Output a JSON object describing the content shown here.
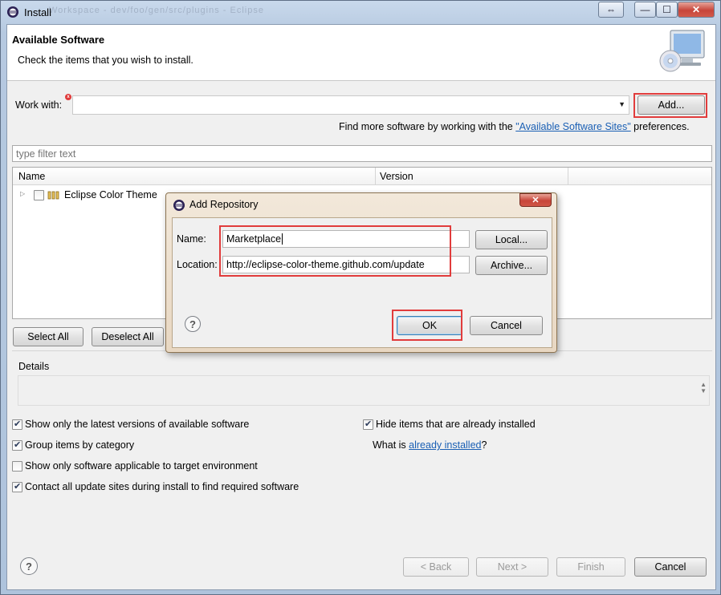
{
  "window": {
    "title": "Install",
    "ghost_title": "Workspace - dev/foo/gen/src/plugins  -  Eclipse",
    "controls": {
      "restore": "⇔",
      "minimize": "—",
      "maximize": "☐",
      "close": "✕"
    }
  },
  "banner": {
    "title": "Available Software",
    "description": "Check the items that you wish to install.",
    "icon": "software-cd-monitor-icon"
  },
  "work_with": {
    "label": "Work with:",
    "value": "",
    "add_button": "Add...",
    "more_text_prefix": "Find more software by working with the ",
    "more_link": "\"Available Software Sites\"",
    "more_text_suffix": " preferences."
  },
  "filter": {
    "placeholder": "type filter text"
  },
  "tree": {
    "columns": [
      "Name",
      "Version"
    ],
    "rows": [
      {
        "name": "Eclipse Color Theme",
        "checked": false
      }
    ]
  },
  "selection_buttons": {
    "select_all": "Select All",
    "deselect_all": "Deselect All"
  },
  "details": {
    "label": "Details"
  },
  "options": {
    "latest_versions": {
      "label": "Show only the latest versions of available software",
      "checked": true
    },
    "group_by_category": {
      "label": "Group items by category",
      "checked": true
    },
    "target_env": {
      "label": "Show only software applicable to target environment",
      "checked": false
    },
    "contact_sites": {
      "label": "Contact all update sites during install to find required software",
      "checked": true
    },
    "hide_installed": {
      "label": "Hide items that are already installed",
      "checked": true
    },
    "what_is_prefix": "What is ",
    "what_is_link": "already installed",
    "what_is_suffix": "?"
  },
  "footer": {
    "back": "< Back",
    "next": "Next >",
    "finish": "Finish",
    "cancel": "Cancel"
  },
  "dialog": {
    "title": "Add Repository",
    "name_label": "Name:",
    "name_value": "Marketplace",
    "location_label": "Location:",
    "location_value": "http://eclipse-color-theme.github.com/update",
    "local_button": "Local...",
    "archive_button": "Archive...",
    "ok_button": "OK",
    "cancel_button": "Cancel",
    "close": "✕"
  },
  "colors": {
    "highlight": "#e13c3c",
    "link": "#1a5fb4"
  }
}
